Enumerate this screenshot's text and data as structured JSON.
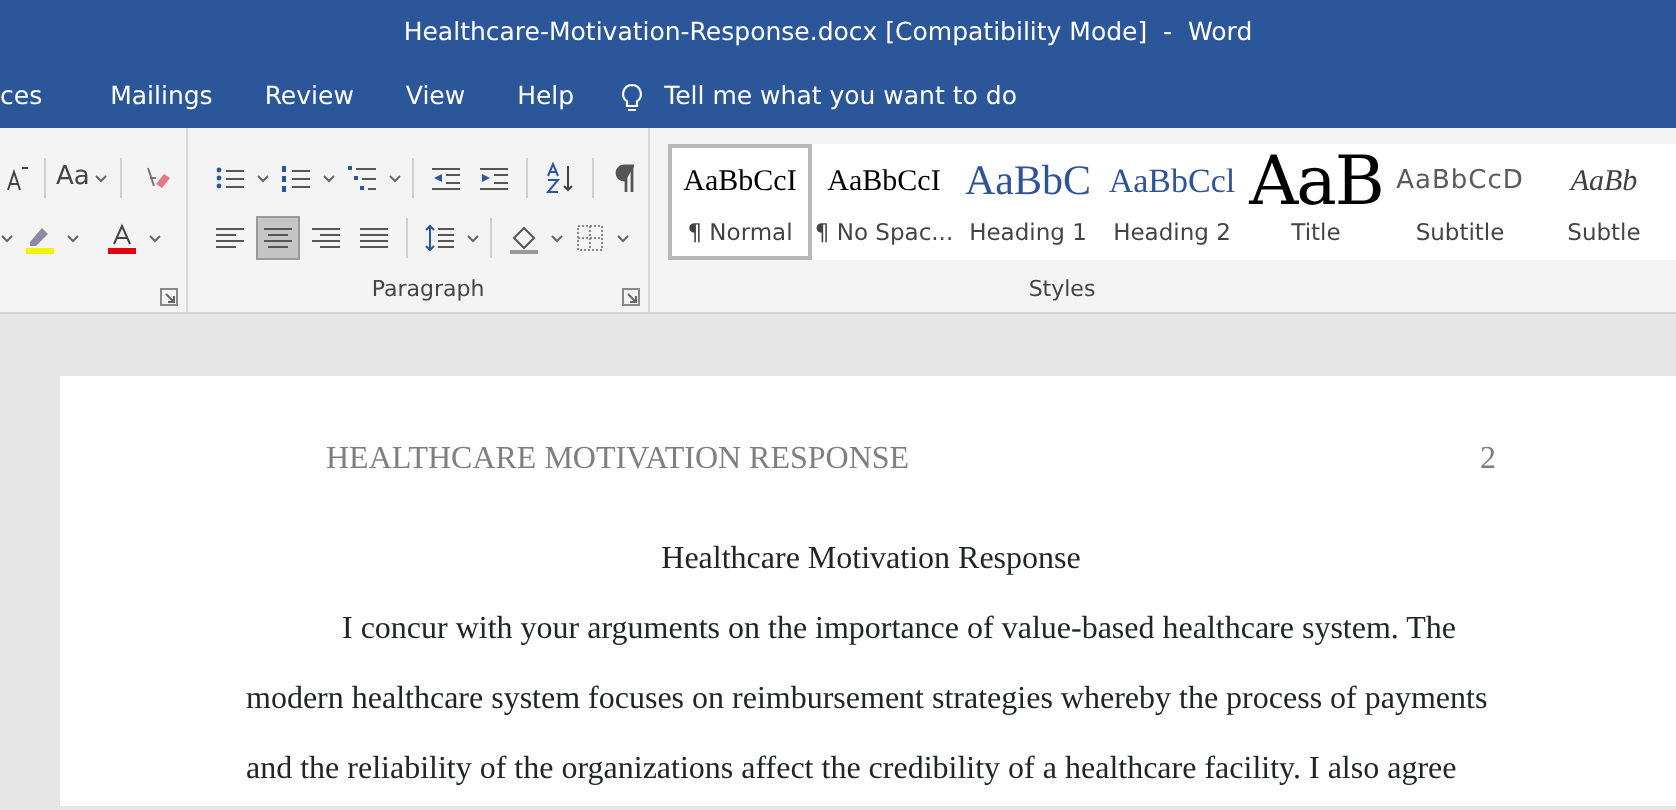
{
  "window": {
    "title": "Healthcare-Motivation-Response.docx [Compatibility Mode]  -  Word"
  },
  "tabs": [
    {
      "label": "ces"
    },
    {
      "label": "Mailings"
    },
    {
      "label": "Review"
    },
    {
      "label": "View"
    },
    {
      "label": "Help"
    }
  ],
  "tell_me": {
    "placeholder": "Tell me what you want to do"
  },
  "paragraph_group": {
    "label": "Paragraph",
    "alignment": [
      {
        "kind": "left",
        "selected": false
      },
      {
        "kind": "center",
        "selected": true
      },
      {
        "kind": "right",
        "selected": false
      },
      {
        "kind": "justify",
        "selected": false
      }
    ]
  },
  "font_group": {
    "case_button": "Aa"
  },
  "styles_group": {
    "label": "Styles",
    "items": [
      {
        "kind": "normal",
        "preview": "AaBbCcI",
        "name": "¶ Normal",
        "selected": true
      },
      {
        "kind": "nospacing",
        "preview": "AaBbCcI",
        "name": "¶ No Spac...",
        "selected": false
      },
      {
        "kind": "heading1",
        "preview": "AaBbC",
        "name": "Heading 1",
        "selected": false
      },
      {
        "kind": "heading2",
        "preview": "AaBbCcl",
        "name": "Heading 2",
        "selected": false
      },
      {
        "kind": "title",
        "preview": "AaB",
        "name": "Title",
        "selected": false
      },
      {
        "kind": "subtitle",
        "preview": "AaBbCcD",
        "name": "Subtitle",
        "selected": false
      },
      {
        "kind": "subtle",
        "preview": "AaBb",
        "name": "Subtle",
        "selected": false
      }
    ]
  },
  "document": {
    "header": "HEALTHCARE MOTIVATION RESPONSE",
    "page_number": "2",
    "heading": "Healthcare Motivation Response",
    "paragraph": "I concur with your arguments on the importance of value-based healthcare system. The modern healthcare system focuses on reimbursement strategies whereby the process of payments and the reliability of the organizations affect the credibility of a healthcare facility. I also agree"
  }
}
